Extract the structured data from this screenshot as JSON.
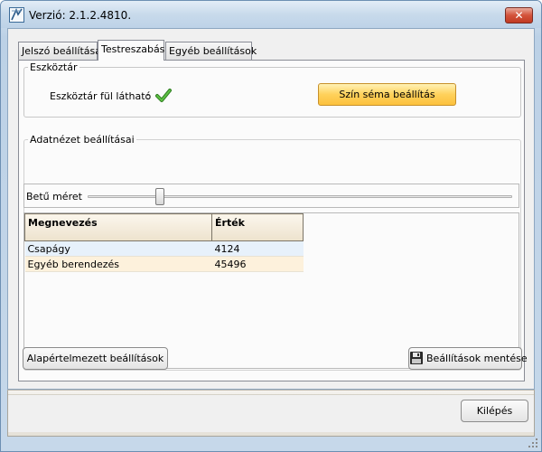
{
  "window": {
    "title": "Verzió: 2.1.2.4810.",
    "close_label": "✕"
  },
  "tabs": [
    {
      "label": "Jelszó beállítása",
      "active": false
    },
    {
      "label": "Testreszabás",
      "active": true
    },
    {
      "label": "Egyéb beállítások",
      "active": false
    }
  ],
  "toolbar_group": {
    "legend": "Eszköztár",
    "visible_label": "Eszköztár fül látható",
    "visible_colon": ":",
    "color_scheme_button": "Szín séma beállítás"
  },
  "dataview_group": {
    "legend": "Adatnézet beállításai",
    "font_size_label": "Betű méret",
    "font_size_slider_fraction": 0.17
  },
  "grid": {
    "columns": [
      "Megnevezés",
      "Érték"
    ],
    "rows": [
      [
        "Csapágy",
        "4124"
      ],
      [
        "Egyéb berendezés",
        "45496"
      ]
    ]
  },
  "buttons": {
    "defaults": "Alapértelmezett beállítások",
    "save": "Beállítások mentése",
    "exit": "Kilépés"
  },
  "colors": {
    "accent_button": "#fcc13d",
    "check_mark": "#3a9a2a"
  }
}
